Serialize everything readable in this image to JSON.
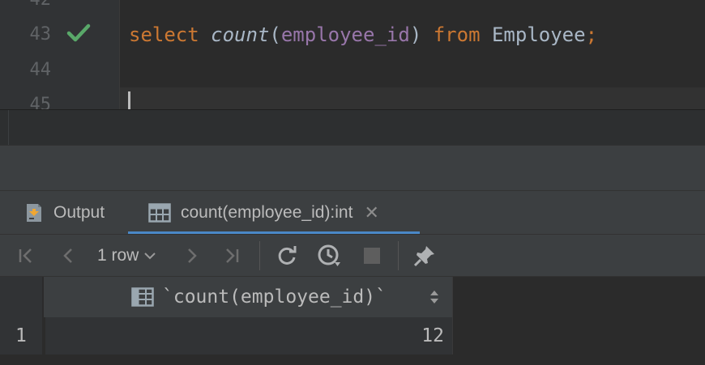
{
  "editor": {
    "line_numbers": [
      "42",
      "43",
      "44",
      "45"
    ],
    "code": {
      "kw_select": "select",
      "fn_count": "count",
      "paren_open": "(",
      "column": "employee_id",
      "paren_close": ")",
      "kw_from": "from",
      "table": "Employee",
      "semicolon": ";"
    },
    "status_icon": "checkmark-icon"
  },
  "tool_window": {
    "tabs": [
      {
        "label": "Output",
        "icon": "output-icon"
      },
      {
        "label": "count(employee_id):int",
        "icon": "table-icon",
        "close": "✕"
      }
    ]
  },
  "toolbar": {
    "rows_label": "1 row",
    "buttons": [
      "first-page-icon",
      "previous-page-icon",
      "next-page-icon",
      "last-page-icon",
      "reload-icon",
      "history-icon",
      "stop-icon",
      "pin-icon"
    ]
  },
  "grid": {
    "column_header": "`count(employee_id)`",
    "rows": [
      {
        "row_number": "1",
        "value": "12"
      }
    ]
  },
  "colors": {
    "keyword": "#cc7832",
    "column": "#9876aa",
    "text": "#a9b7c6",
    "check": "#59a869",
    "tab_underline": "#4a88c7"
  }
}
